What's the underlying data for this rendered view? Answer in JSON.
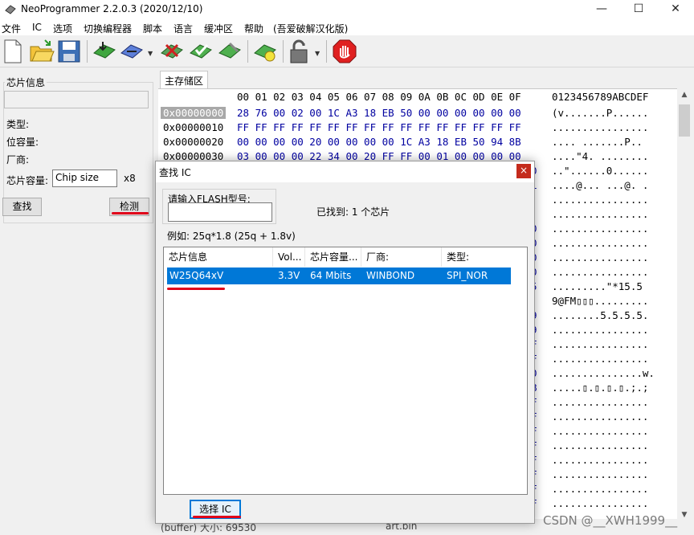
{
  "window": {
    "title": "NeoProgrammer 2.2.0.3 (2020/12/10)",
    "controls": {
      "minimize": "—",
      "maximize": "☐",
      "close": "✕"
    }
  },
  "menu": [
    "文件",
    "IC",
    "选项",
    "切换编程器",
    "脚本",
    "语言",
    "缓冲区",
    "帮助",
    "(吾爱破解汉化版)"
  ],
  "toolbar": {
    "icons": [
      "new-file-icon",
      "open-folder-icon",
      "save-disk-icon",
      "read-chip-icon",
      "write-chip-icon",
      "erase-chip-icon",
      "blank-check-icon",
      "verify-chip-icon",
      "auto-chip-icon",
      "lock-icon",
      "stop-icon"
    ]
  },
  "left_panel": {
    "group_title": "芯片信息",
    "type_label": "类型:",
    "bits_label": "位容量:",
    "vendor_label": "厂商:",
    "capacity_label": "芯片容量:",
    "capacity_value": "Chip size",
    "multiplier": "x8",
    "find_button": "查找",
    "detect_button": "检测"
  },
  "hex": {
    "tab": "主存储区",
    "header_bytes": "00 01 02 03 04 05 06 07 08 09 0A 0B 0C 0D 0E 0F",
    "header_ascii": "0123456789ABCDEF",
    "rows": [
      {
        "addr": "0x00000000",
        "bytes": "28 76 00 02 00 1C A3 18 EB 50 00 00 00 00 00 00",
        "ascii": "(v.......P......"
      },
      {
        "addr": "0x00000010",
        "bytes": "FF FF FF FF FF FF FF FF FF FF FF FF FF FF FF FF",
        "ascii": "................"
      },
      {
        "addr": "0x00000020",
        "bytes": "00 00 00 00 20 00 00 00 00 1C A3 18 EB 50 94 8B",
        "ascii": ".... .......P.."
      },
      {
        "addr": "0x00000030",
        "bytes": "03 00 00 00 22 34 00 20 FF FF 00 01 00 00 00 00",
        "ascii": "....\"4. ........"
      }
    ],
    "partial_rows": [
      {
        "last": "0",
        "ascii": "..\"......0......"
      },
      {
        "last": "1",
        "ascii": "....@... ...@. ."
      },
      {
        "last": "",
        "ascii": "................"
      },
      {
        "last": "",
        "ascii": "................"
      },
      {
        "last": "0",
        "ascii": "................"
      },
      {
        "last": "0",
        "ascii": "................"
      },
      {
        "last": "0",
        "ascii": "................"
      },
      {
        "last": "0",
        "ascii": "................"
      },
      {
        "last": "5",
        "ascii": ".........\"*15.5"
      },
      {
        "last": "",
        "ascii": "9@FM▯▯▯........."
      },
      {
        "last": "9",
        "ascii": "........5.5.5.5."
      },
      {
        "last": "9",
        "ascii": "................"
      },
      {
        "last": "F",
        "ascii": "................"
      },
      {
        "last": "F",
        "ascii": "................"
      },
      {
        "last": "0",
        "ascii": "...............w."
      },
      {
        "last": "B",
        "ascii": ".....▯.▯.▯.▯.;.;"
      },
      {
        "last": "F",
        "ascii": "................"
      },
      {
        "last": "F",
        "ascii": "................"
      },
      {
        "last": "F",
        "ascii": "................"
      },
      {
        "last": "F",
        "ascii": "................"
      },
      {
        "last": "F",
        "ascii": "................"
      },
      {
        "last": "F",
        "ascii": "................"
      },
      {
        "last": "F",
        "ascii": "................"
      },
      {
        "last": "F",
        "ascii": "................"
      }
    ]
  },
  "status": {
    "left": "(buffer) 大小: 69530",
    "right": "art.bin"
  },
  "dialog": {
    "title": "查找 IC",
    "close": "×",
    "input_label": "请输入FLASH型号:",
    "input_value": "",
    "found_text": "已找到: 1 个芯片",
    "example_text": "例如:   25q*1.8 (25q + 1.8v)",
    "columns": [
      "芯片信息",
      "Vol...",
      "芯片容量...",
      "厂商:",
      "类型:"
    ],
    "rows": [
      {
        "name": "W25Q64xV",
        "vol": "3.3V",
        "size": "64 Mbits",
        "vendor": "WINBOND",
        "type": "SPI_NOR"
      }
    ],
    "select_button": "选择 IC"
  },
  "watermark": "CSDN @__XWH1999__",
  "colors": {
    "selection": "#0078d7",
    "annotation": "#e0001a",
    "hex_bytes": "#0000a0"
  }
}
